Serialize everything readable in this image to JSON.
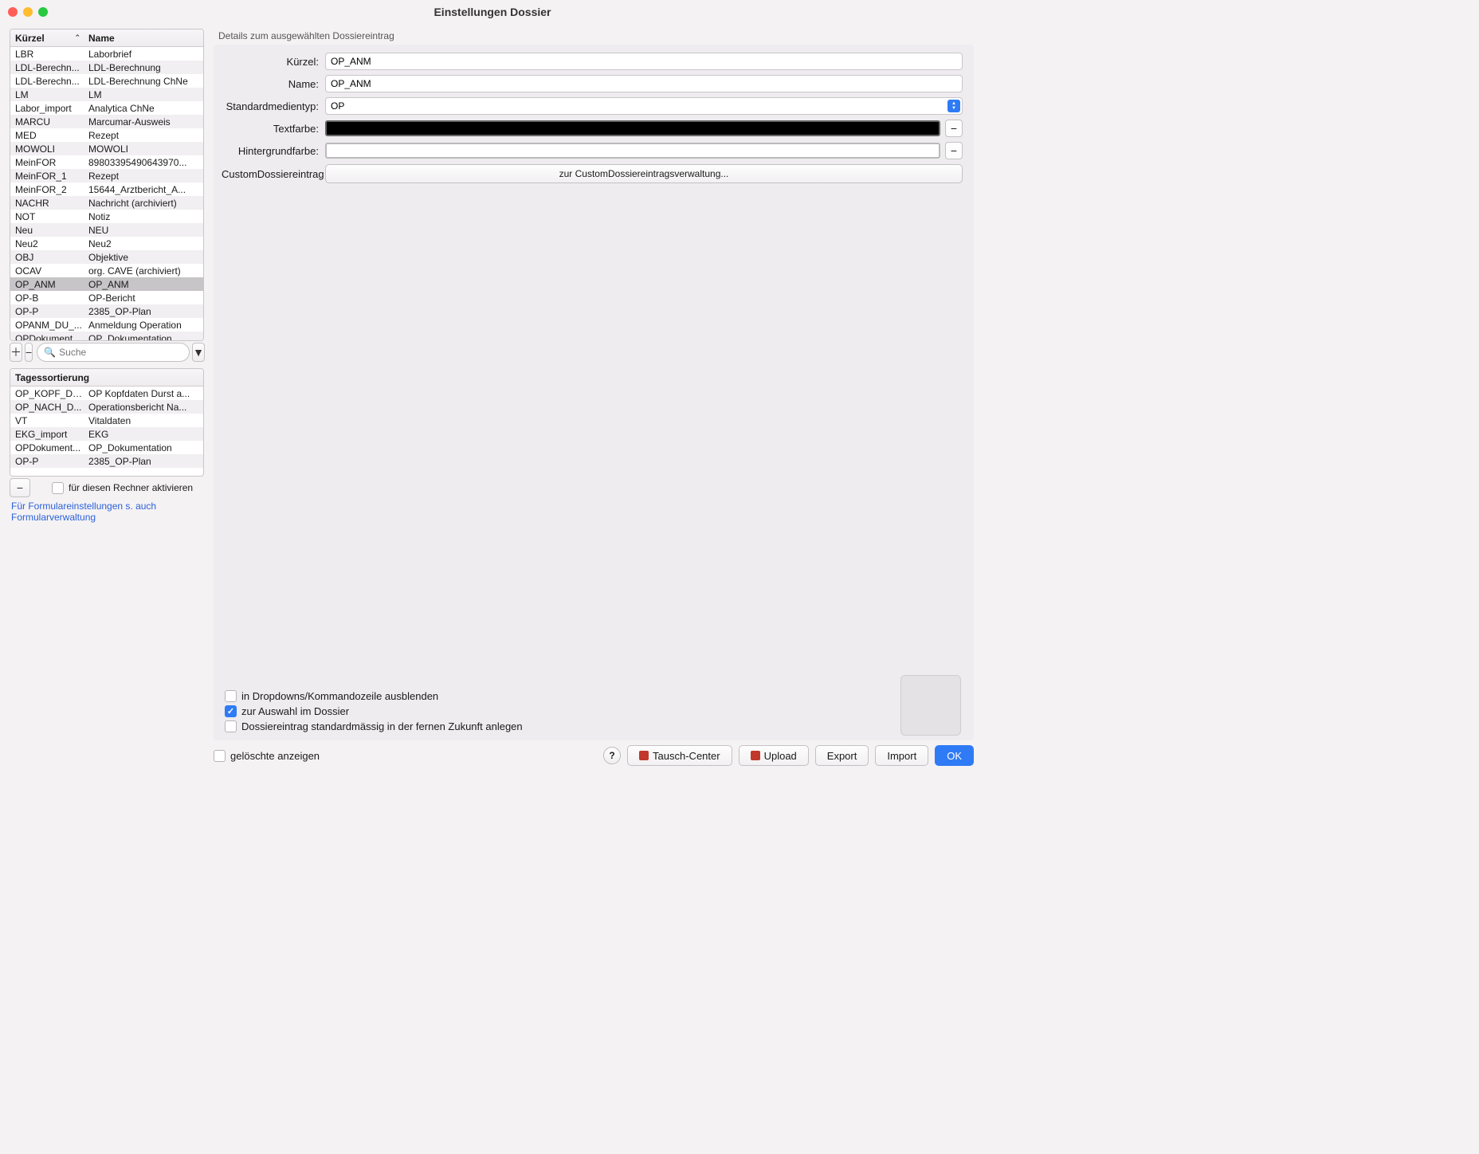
{
  "window": {
    "title": "Einstellungen Dossier"
  },
  "columns": {
    "kuerzel": "Kürzel",
    "name": "Name"
  },
  "main_rows": [
    {
      "k": "LBR",
      "n": "Laborbrief"
    },
    {
      "k": "LDL-Berechn...",
      "n": "LDL-Berechnung"
    },
    {
      "k": "LDL-Berechn...",
      "n": "LDL-Berechnung ChNe"
    },
    {
      "k": "LM",
      "n": "LM"
    },
    {
      "k": "Labor_import",
      "n": "Analytica ChNe"
    },
    {
      "k": "MARCU",
      "n": "Marcumar-Ausweis"
    },
    {
      "k": "MED",
      "n": "Rezept"
    },
    {
      "k": "MOWOLI",
      "n": "MOWOLI"
    },
    {
      "k": "MeinFOR",
      "n": "89803395490643970..."
    },
    {
      "k": "MeinFOR_1",
      "n": "Rezept"
    },
    {
      "k": "MeinFOR_2",
      "n": "15644_Arztbericht_A..."
    },
    {
      "k": "NACHR",
      "n": "Nachricht (archiviert)"
    },
    {
      "k": "NOT",
      "n": "Notiz"
    },
    {
      "k": "Neu",
      "n": "NEU"
    },
    {
      "k": "Neu2",
      "n": "Neu2"
    },
    {
      "k": "OBJ",
      "n": "Objektive"
    },
    {
      "k": "OCAV",
      "n": "org. CAVE (archiviert)"
    },
    {
      "k": "OP_ANM",
      "n": "OP_ANM",
      "selected": true
    },
    {
      "k": "OP-B",
      "n": "OP-Bericht"
    },
    {
      "k": "OP-P",
      "n": "2385_OP-Plan"
    },
    {
      "k": "OPANM_DU_...",
      "n": "Anmeldung Operation"
    },
    {
      "k": "OPDokument...",
      "n": "OP_Dokumentation"
    }
  ],
  "search": {
    "placeholder": "Suche"
  },
  "sort_header": "Tagessortierung",
  "sort_rows": [
    {
      "k": "OP_KOPF_DU...",
      "n": "OP Kopfdaten Durst a..."
    },
    {
      "k": "OP_NACH_D...",
      "n": "Operationsbericht Na..."
    },
    {
      "k": "VT",
      "n": "Vitaldaten"
    },
    {
      "k": "EKG_import",
      "n": "EKG"
    },
    {
      "k": "OPDokument...",
      "n": "OP_Dokumentation"
    },
    {
      "k": "OP-P",
      "n": "2385_OP-Plan"
    }
  ],
  "activate_label": "für diesen Rechner aktivieren",
  "footer_link": "Für Formulareinstellungen s. auch Formularverwaltung",
  "details": {
    "heading": "Details zum ausgewählten Dossiereintrag",
    "kuerzel_label": "Kürzel:",
    "kuerzel_value": "OP_ANM",
    "name_label": "Name:",
    "name_value": "OP_ANM",
    "medientyp_label": "Standardmedientyp:",
    "medientyp_value": "OP",
    "textfarbe_label": "Textfarbe:",
    "hintergrund_label": "Hintergrundfarbe:",
    "custom_label": "CustomDossiereintrag",
    "custom_button": "zur CustomDossiereintragsverwaltung...",
    "chk_hide": "in Dropdowns/Kommandozeile ausblenden",
    "chk_auswahl": "zur Auswahl im Dossier",
    "chk_future": "Dossiereintrag standardmässig in der fernen Zukunft anlegen"
  },
  "bottom": {
    "deleted": "gelöschte anzeigen",
    "tausch": "Tausch-Center",
    "upload": "Upload",
    "export": "Export",
    "import": "Import",
    "ok": "OK"
  }
}
